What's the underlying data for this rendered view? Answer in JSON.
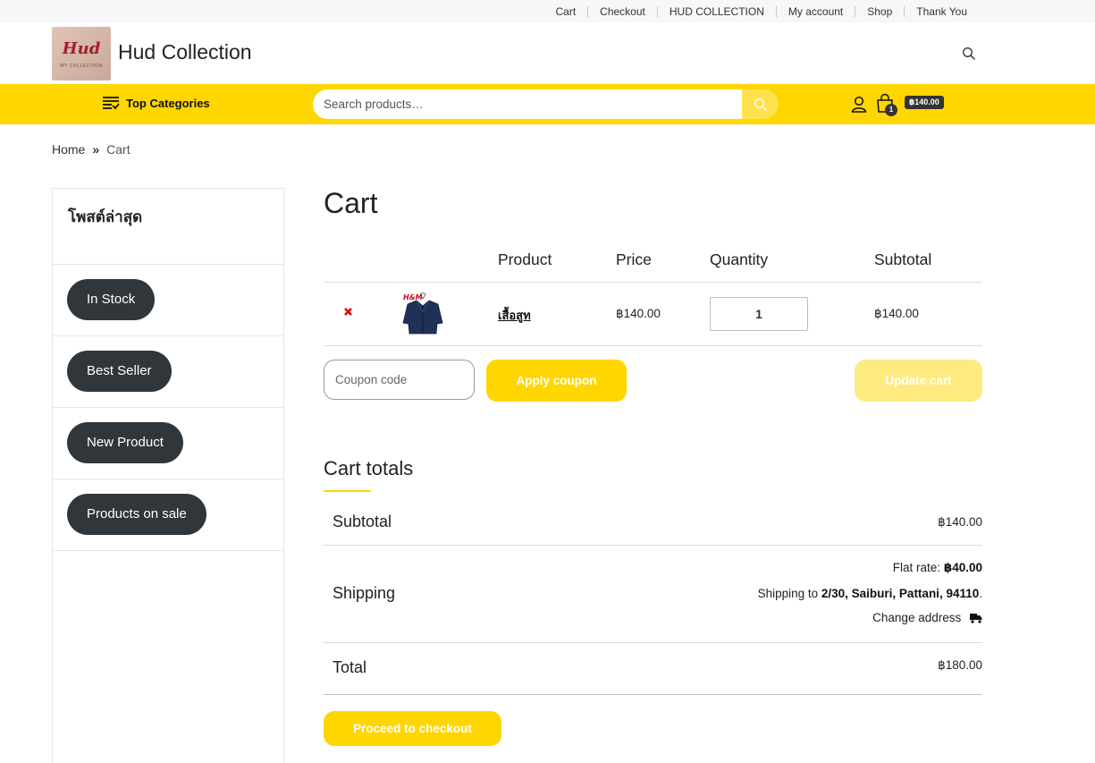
{
  "topnav": [
    "Cart",
    "Checkout",
    "HUD COLLECTION",
    "My account",
    "Shop",
    "Thank You"
  ],
  "logo": {
    "line1": "Hud",
    "line2": "MY COLLECTION"
  },
  "site_title": "Hud Collection",
  "nav": {
    "top_categories": "Top Categories",
    "search_placeholder": "Search products…",
    "cart_count": "1",
    "cart_amount": "฿140.00"
  },
  "breadcrumb": {
    "home": "Home",
    "sep": "»",
    "current": "Cart"
  },
  "sidebar": {
    "title": "โพสต์ล่าสุด",
    "tags": [
      "In Stock",
      "Best Seller",
      "New Product",
      "Products on sale"
    ]
  },
  "cart": {
    "title": "Cart",
    "headers": {
      "product": "Product",
      "price": "Price",
      "quantity": "Quantity",
      "subtotal": "Subtotal"
    },
    "item": {
      "name": "เสื้อสูท",
      "price": "฿140.00",
      "quantity": "1",
      "subtotal": "฿140.00"
    },
    "coupon_placeholder": "Coupon code",
    "apply_label": "Apply coupon",
    "update_label": "Update cart"
  },
  "totals": {
    "title": "Cart totals",
    "subtotal_label": "Subtotal",
    "subtotal_value": "฿140.00",
    "shipping_label": "Shipping",
    "flat_rate_label": "Flat rate:",
    "flat_rate_value": "฿40.00",
    "shipping_to_label": "Shipping to",
    "shipping_address": "2/30, Saiburi, Pattani, 94110",
    "change_address": "Change address",
    "total_label": "Total",
    "total_value": "฿180.00",
    "checkout_label": "Proceed to checkout"
  },
  "colors": {
    "accent": "#ffd600",
    "accent_light": "#ffea80",
    "dark": "#31363b",
    "remove": "#e00000"
  }
}
